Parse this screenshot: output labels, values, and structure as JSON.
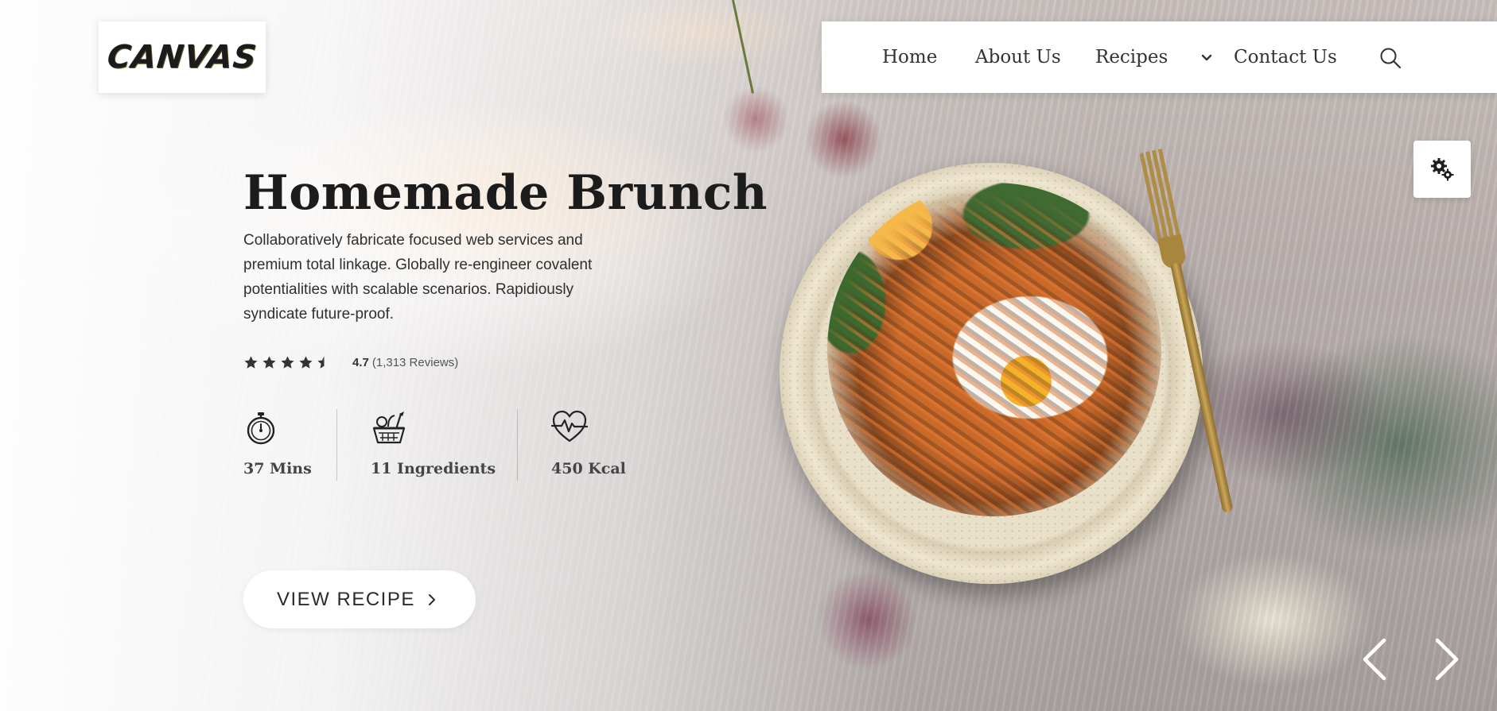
{
  "logo": {
    "text": "CANVAS"
  },
  "nav": {
    "items": [
      {
        "label": "Home"
      },
      {
        "label": "About Us"
      },
      {
        "label": "Recipes"
      },
      {
        "label": "Contact Us"
      }
    ]
  },
  "hero": {
    "title": "Homemade Brunch",
    "description": "Collaboratively fabricate focused web services and premium total linkage. Globally re-engineer covalent potentialities with scalable scenarios. Rapidiously syndicate future-proof.",
    "rating": {
      "value": "4.7",
      "count": "(1,313 Reviews)",
      "stars": 4.5
    },
    "stats": [
      {
        "icon": "stopwatch-icon",
        "label": "37 Mins"
      },
      {
        "icon": "ingredients-basket-icon",
        "label": "11 Ingredients"
      },
      {
        "icon": "heart-rate-icon",
        "label": "450 Kcal"
      }
    ],
    "cta": {
      "label": "VIEW RECIPE"
    }
  },
  "colors": {
    "text_dark": "#1c1c1c",
    "panel_bg": "#ffffff",
    "star": "#333333"
  }
}
